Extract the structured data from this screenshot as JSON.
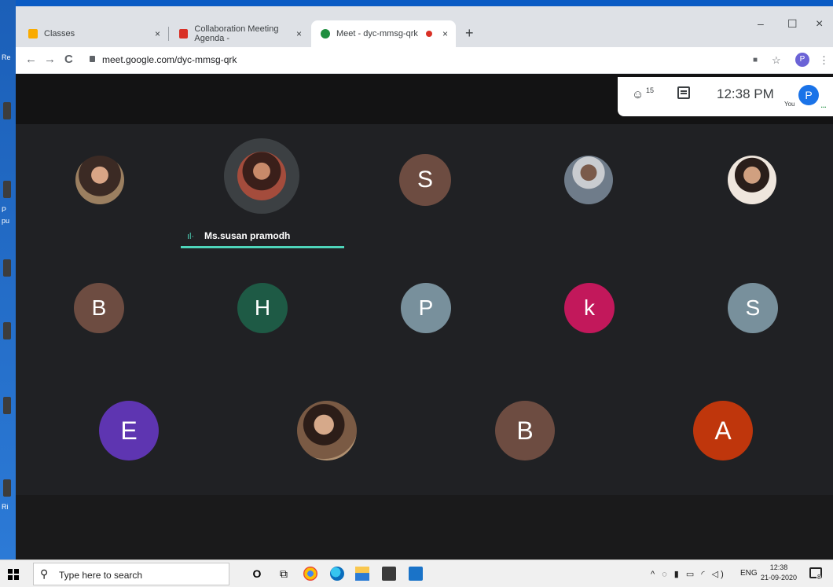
{
  "desktop": {
    "labels": [
      "Re",
      "P",
      "pu",
      "Ri"
    ]
  },
  "browser": {
    "tabs": [
      {
        "title": "Classes",
        "favicon_color": "#f9ab00"
      },
      {
        "title": "Collaboration Meeting Agenda -",
        "favicon_color": "#d93025"
      },
      {
        "title": "Meet - dyc-mmsg-qrk",
        "favicon_color": "#1e8e3e"
      }
    ],
    "tab_close_glyph": "×",
    "new_tab_glyph": "+",
    "window_controls": {
      "minimize": "–",
      "maximize": "☐",
      "close": "×"
    },
    "url": "meet.google.com/dyc-mmsg-qrk",
    "profile_initial": "P",
    "nav": {
      "back": "←",
      "forward": "→",
      "reload": "C"
    },
    "toolbar_icons": {
      "camera": "■",
      "star": "☆",
      "menu": "⋮"
    }
  },
  "meet": {
    "participant_count": "15",
    "time": "12:38 PM",
    "you_label": "You",
    "you_initial": "P",
    "active_speaker": "Ms.susan pramodh",
    "speaker_indicator": "ıl·",
    "participants_row1": [
      {
        "kind": "photo",
        "name": "participant-photo-1",
        "color": "#7a5a3c"
      },
      {
        "kind": "photo",
        "name": "participant-photo-speaker",
        "color": "#9a5a44"
      },
      {
        "kind": "initial",
        "initial": "S",
        "color": "#6d4c41"
      },
      {
        "kind": "photo",
        "name": "participant-photo-3",
        "color": "#8c8c8c"
      },
      {
        "kind": "photo",
        "name": "participant-photo-4",
        "color": "#d9b8a0"
      }
    ],
    "participants_row2": [
      {
        "initial": "B",
        "color": "#6d4c41"
      },
      {
        "initial": "H",
        "color": "#1e5a45"
      },
      {
        "initial": "P",
        "color": "#78909c"
      },
      {
        "initial": "k",
        "color": "#c2185b"
      },
      {
        "initial": "S",
        "color": "#78909c"
      }
    ],
    "participants_row3": [
      {
        "kind": "initial",
        "initial": "E",
        "color": "#5e35b1"
      },
      {
        "kind": "photo",
        "name": "participant-photo-5",
        "color": "#5a4030"
      },
      {
        "kind": "initial",
        "initial": "B",
        "color": "#6d4c41"
      },
      {
        "kind": "initial",
        "initial": "A",
        "color": "#bf360c"
      }
    ]
  },
  "taskbar": {
    "search_placeholder": "Type here to search",
    "search_glyph": "⚲",
    "cortana_glyph": "O",
    "taskview_glyph": "⧉",
    "language": "ENG",
    "clock_time": "12:38",
    "clock_date": "21-09-2020",
    "notification_count": "8",
    "tray_glyphs": "^ ◌ ▮ ▭ ◜ ◁)"
  }
}
